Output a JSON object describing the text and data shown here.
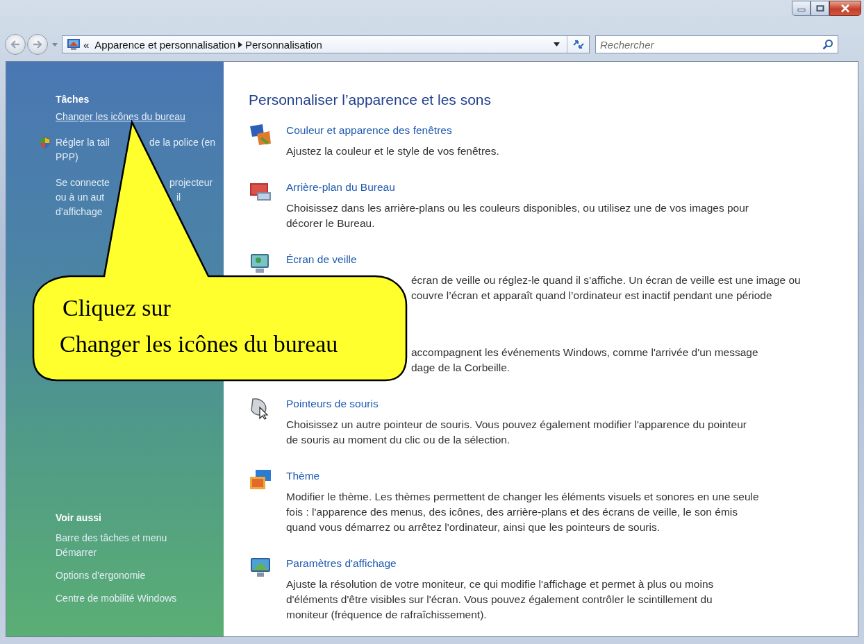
{
  "navigation": {
    "breadcrumb_overflow": "«",
    "path": [
      "Apparence et personnalisation",
      "Personnalisation"
    ]
  },
  "search": {
    "placeholder": "Rechercher"
  },
  "sidebar": {
    "sections": [
      {
        "heading": "Tâches",
        "items": [
          {
            "kind": "link",
            "hovered": true,
            "lines": [
              [
                "Changer les icônes du bureau"
              ]
            ]
          },
          {
            "kind": "shield-link",
            "hovered": false,
            "lines": [
              [
                "Régler la tail",
                "de la police (en"
              ],
              [
                "PPP)"
              ]
            ]
          },
          {
            "kind": "link",
            "hovered": false,
            "lines": [
              [
                "Se connecte",
                "projecteur"
              ],
              [
                "ou à un aut",
                "il"
              ],
              [
                "d’affichage"
              ]
            ]
          }
        ]
      },
      {
        "heading": "Voir aussi",
        "items": [
          {
            "kind": "link",
            "hovered": false,
            "lines": [
              [
                "Barre des tâches et menu"
              ],
              [
                "Démarrer"
              ]
            ]
          },
          {
            "kind": "link",
            "hovered": false,
            "lines": [
              [
                "Options d’ergonomie"
              ]
            ]
          },
          {
            "kind": "link",
            "hovered": false,
            "lines": [
              [
                "Centre de mobilité Windows"
              ]
            ]
          }
        ]
      }
    ]
  },
  "content": {
    "title": "Personnaliser l’apparence et les sons",
    "items": [
      {
        "title": "Couleur et apparence des fenêtres",
        "lines": [
          {
            "kind": "full",
            "text": "Ajustez la couleur et le style de vos fenêtres."
          }
        ]
      },
      {
        "title": "Arrière-plan du Bureau",
        "lines": [
          {
            "kind": "full",
            "text": "Choisissez dans les arrière-plans ou les couleurs disponibles, ou utilisez une de vos images pour"
          },
          {
            "kind": "full",
            "text": "décorer le Bureau."
          }
        ]
      },
      {
        "title": "Écran de veille",
        "lines": [
          {
            "kind": "partial",
            "text": "écran de veille ou réglez-le quand il s’affiche. Un écran de veille est une image ou"
          },
          {
            "kind": "partial",
            "text": "couvre l’écran et apparaît quand l’ordinateur est inactif pendant une période"
          }
        ]
      },
      {
        "lines": [
          {
            "kind": "partial",
            "text": "accompagnent les événements Windows, comme l'arrivée d'un message"
          },
          {
            "kind": "partial",
            "text": "dage de la Corbeille."
          }
        ]
      },
      {
        "title": "Pointeurs de souris",
        "lines": [
          {
            "kind": "full",
            "text": "Choisissez un autre pointeur de souris. Vous pouvez également modifier l'apparence du pointeur"
          },
          {
            "kind": "full",
            "text": "de souris au moment du clic ou de la sélection."
          }
        ]
      },
      {
        "title": "Thème",
        "lines": [
          {
            "kind": "full",
            "text": "Modifier le thème. Les thèmes permettent de changer les éléments visuels et sonores en une seule"
          },
          {
            "kind": "full",
            "text": "fois : l'apparence des menus, des icônes, des arrière-plans et des écrans de veille, le son émis"
          },
          {
            "kind": "full",
            "text": "quand vous démarrez ou arrêtez l'ordinateur, ainsi que les pointeurs de souris."
          }
        ]
      },
      {
        "title": "Paramètres d'affichage",
        "lines": [
          {
            "kind": "full",
            "text": "Ajuste la résolution de votre moniteur, ce qui modifie l'affichage et permet à plus ou moins"
          },
          {
            "kind": "full",
            "text": "d'éléments d'être visibles sur l'écran. Vous pouvez également contrôler le scintillement du"
          },
          {
            "kind": "full",
            "text": "moniteur (fréquence de rafraîchissement)."
          }
        ]
      }
    ]
  },
  "callout": {
    "lines": [
      "Cliquez sur",
      "Changer les icônes du bureau"
    ]
  }
}
